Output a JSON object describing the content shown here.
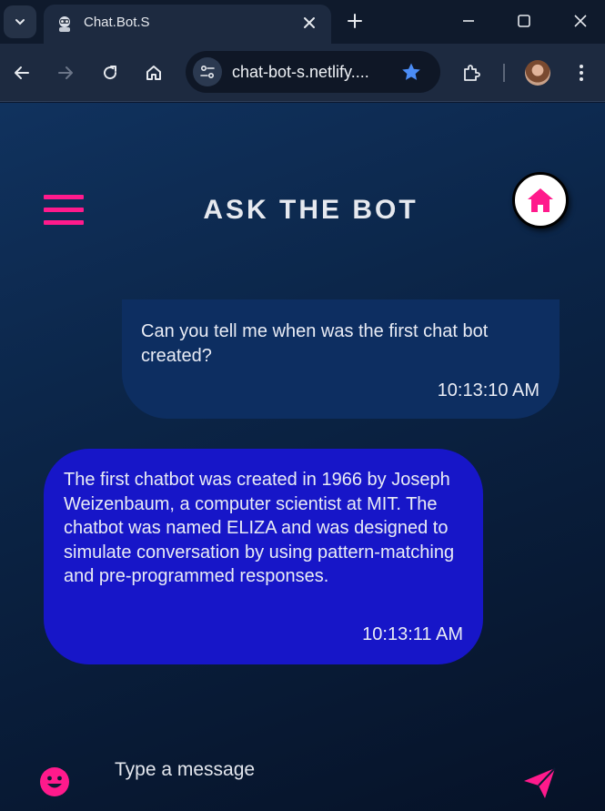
{
  "browser": {
    "tab_title": "Chat.Bot.S",
    "url": "chat-bot-s.netlify....",
    "accent_color": "#4b8cf5"
  },
  "header": {
    "title": "ASK THE BOT",
    "menu_icon": "hamburger-menu-icon",
    "home_icon": "home-icon"
  },
  "messages": [
    {
      "sender": "user",
      "text": "Can you tell me when was the first chat bot created?",
      "time": "10:13:10 AM"
    },
    {
      "sender": "bot",
      "text": "The first chatbot was created in 1966 by Joseph Weizenbaum, a computer scientist at MIT. The chatbot was named ELIZA and was designed to simulate conversation by using pattern-matching and pre-programmed responses.",
      "time": "10:13:11 AM"
    }
  ],
  "composer": {
    "placeholder": "Type a message",
    "value": "",
    "emoji_icon": "smiley-icon",
    "send_icon": "send-icon"
  },
  "colors": {
    "accent": "#ff1a8c",
    "user_bubble": "#0d2e61",
    "bot_bubble": "#1716c8",
    "page_background": "#0b2446"
  }
}
